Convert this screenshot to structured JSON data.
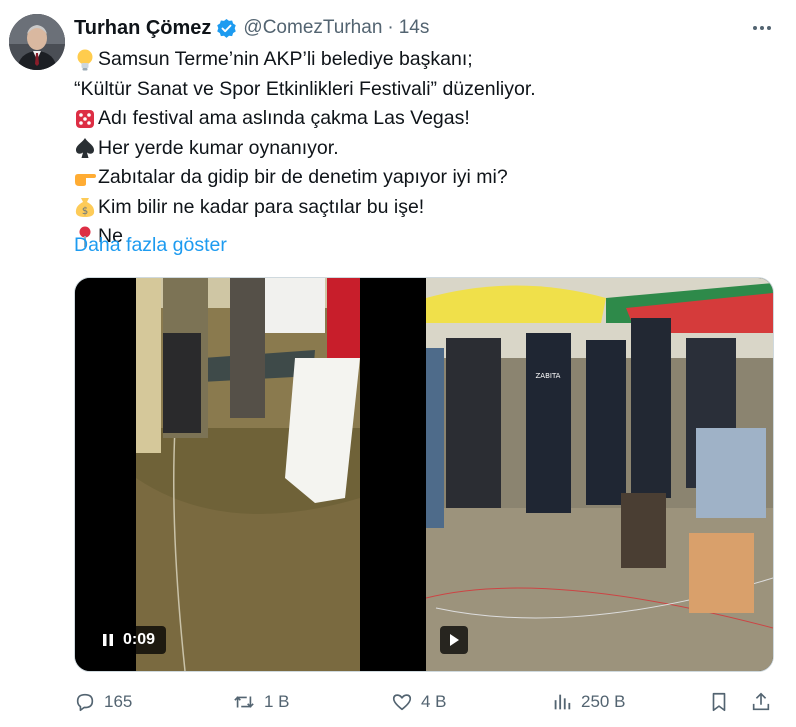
{
  "tweet": {
    "author_name": "Turhan Çömez",
    "handle": "@ComezTurhan",
    "separator": "·",
    "time": "14s",
    "lines": [
      {
        "emoji": "light-bulb",
        "text": "Samsun Terme’nin AKP’li belediye başkanı;"
      },
      {
        "emoji": "",
        "text": "“Kültür Sanat ve Spor Etkinlikleri Festivali” düzenliyor."
      },
      {
        "emoji": "dice",
        "text": "Adı festival ama aslında çakma Las Vegas!"
      },
      {
        "emoji": "spade",
        "text": "Her yerde kumar oynanıyor."
      },
      {
        "emoji": "pointing-hand",
        "text": "Zabıtalar da gidip bir de denetim yapıyor iyi mi?"
      },
      {
        "emoji": "money-bag",
        "text": "Kim bilir ne kadar para saçtılar bu işe!"
      },
      {
        "emoji": "round-pushpin",
        "text": "Ne"
      }
    ],
    "show_more": "Daha fazla göster"
  },
  "media": {
    "video1_time": "0:09",
    "video1_state": "playing",
    "video2_state": "paused",
    "video2_label": "ZABITA"
  },
  "actions": {
    "replies": "165",
    "reposts": "1 B",
    "likes": "4 B",
    "views": "250 B"
  },
  "colors": {
    "accent": "#1d9bf0",
    "secondary_text": "#536471",
    "primary_text": "#0f1419"
  }
}
